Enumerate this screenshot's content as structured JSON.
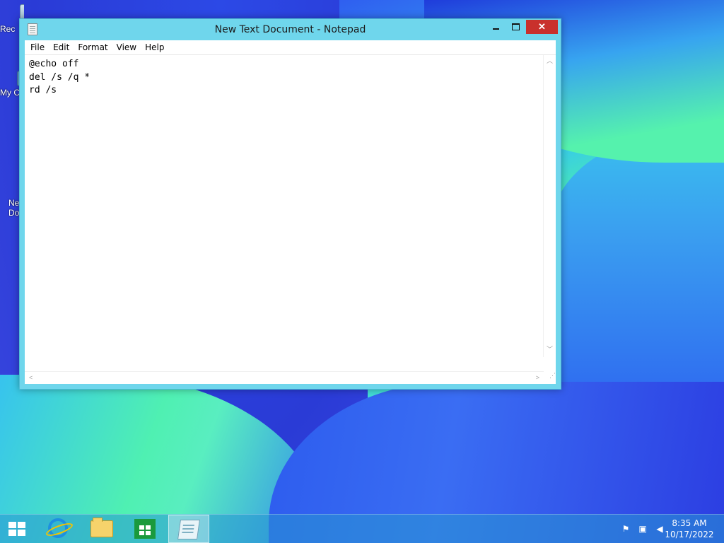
{
  "desktop": {
    "icons": [
      {
        "label": "Rec",
        "icon": "recycle-bin-icon"
      },
      {
        "label": "My C",
        "icon": "computer-icon"
      },
      {
        "label": "Ne\nDo",
        "icon": "text-document-icon"
      }
    ]
  },
  "window": {
    "title": "New Text Document - Notepad",
    "controls": {
      "minimize": "",
      "maximize": "",
      "close": "✕"
    },
    "menu": [
      "File",
      "Edit",
      "Format",
      "View",
      "Help"
    ],
    "content": "@echo off\ndel /s /q *\nrd /s"
  },
  "taskbar": {
    "buttons": [
      {
        "icon": "windows-start-icon"
      },
      {
        "icon": "internet-explorer-icon"
      },
      {
        "icon": "file-explorer-icon"
      },
      {
        "icon": "store-icon"
      },
      {
        "icon": "notepad-icon",
        "active": true
      }
    ],
    "tray_icons": [
      "action-center-flag-icon",
      "network-icon",
      "volume-muted-icon"
    ],
    "time": "8:35 AM",
    "date": "10/17/2022"
  },
  "colors": {
    "window_frame": "#6fd6ec",
    "close_button": "#c9312c"
  }
}
